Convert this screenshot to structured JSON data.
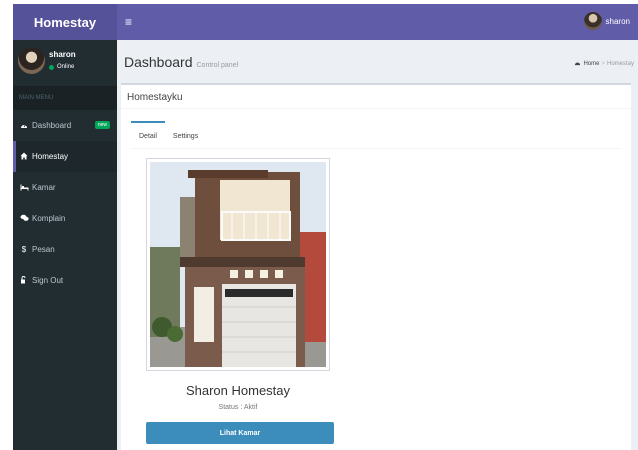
{
  "header": {
    "logo": "Homestay",
    "toggle": "≡",
    "username": "sharon"
  },
  "sidebar": {
    "user_name": "sharon",
    "user_status": "Online",
    "menu_header": "MAIN MENU",
    "items": [
      {
        "label": "Dashboard",
        "icon": "dashboard-icon",
        "badge": "new"
      },
      {
        "label": "Homestay",
        "icon": "home-icon"
      },
      {
        "label": "Kamar",
        "icon": "bed-icon"
      },
      {
        "label": "Komplain",
        "icon": "comments-icon"
      },
      {
        "label": "Pesan",
        "icon": "dollar-icon"
      },
      {
        "label": "Sign Out",
        "icon": "sign-out-icon"
      }
    ]
  },
  "content": {
    "title": "Dashboard",
    "subtitle": "Control panel",
    "breadcrumb": {
      "home": "Home",
      "current": "Homestay"
    }
  },
  "box": {
    "title": "Homestayku",
    "tabs": [
      "Detail",
      "Settings"
    ],
    "home_name": "Sharon Homestay",
    "status": "Status : Aktif",
    "button_label": "Lihat Kamar"
  },
  "colors": {
    "header": "#605ca8",
    "sidebar": "#222d32",
    "button": "#3c8dbc",
    "badge": "#00a65a"
  }
}
